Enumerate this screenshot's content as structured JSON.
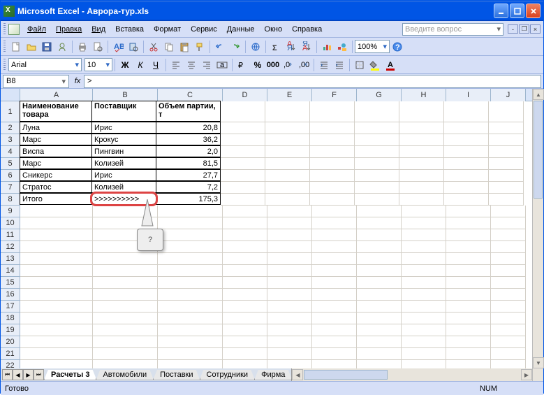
{
  "app": {
    "title": "Microsoft Excel - Аврора-тур.xls"
  },
  "menu": {
    "items": [
      "Файл",
      "Правка",
      "Вид",
      "Вставка",
      "Формат",
      "Сервис",
      "Данные",
      "Окно",
      "Справка"
    ],
    "search_placeholder": "Введите вопрос"
  },
  "formatting": {
    "font_name": "Arial",
    "font_size": "10",
    "zoom": "100%"
  },
  "namebox": {
    "ref": "B8"
  },
  "formula": {
    "value": ">"
  },
  "columns": [
    "A",
    "B",
    "C",
    "D",
    "E",
    "F",
    "G",
    "H",
    "I",
    "J"
  ],
  "headers": {
    "A": "Наименование товара",
    "B": "Поставщик",
    "C": "Объем партии, т"
  },
  "rows": [
    {
      "n": 2,
      "A": "Луна",
      "B": "Ирис",
      "C": "20,8"
    },
    {
      "n": 3,
      "A": "Марс",
      "B": "Крокус",
      "C": "36,2"
    },
    {
      "n": 4,
      "A": "Виспа",
      "B": "Пингвин",
      "C": "2,0"
    },
    {
      "n": 5,
      "A": "Марс",
      "B": "Колизей",
      "C": "81,5"
    },
    {
      "n": 6,
      "A": "Сникерс",
      "B": "Ирис",
      "C": "27,7"
    },
    {
      "n": 7,
      "A": "Стратос",
      "B": "Колизей",
      "C": "7,2"
    },
    {
      "n": 8,
      "A": "Итого",
      "B": ">>>>>>>>>>",
      "C": "175,3"
    }
  ],
  "empty_rows": [
    9,
    10,
    11,
    12,
    13,
    14,
    15,
    16,
    17,
    18,
    19,
    20,
    21,
    22
  ],
  "callout": {
    "text": "?"
  },
  "sheets": {
    "tabs": [
      "Расчеты 3",
      "Автомобили",
      "Поставки",
      "Сотрудники",
      "Фирма"
    ],
    "active": 0
  },
  "status": {
    "ready": "Готово",
    "num": "NUM"
  }
}
